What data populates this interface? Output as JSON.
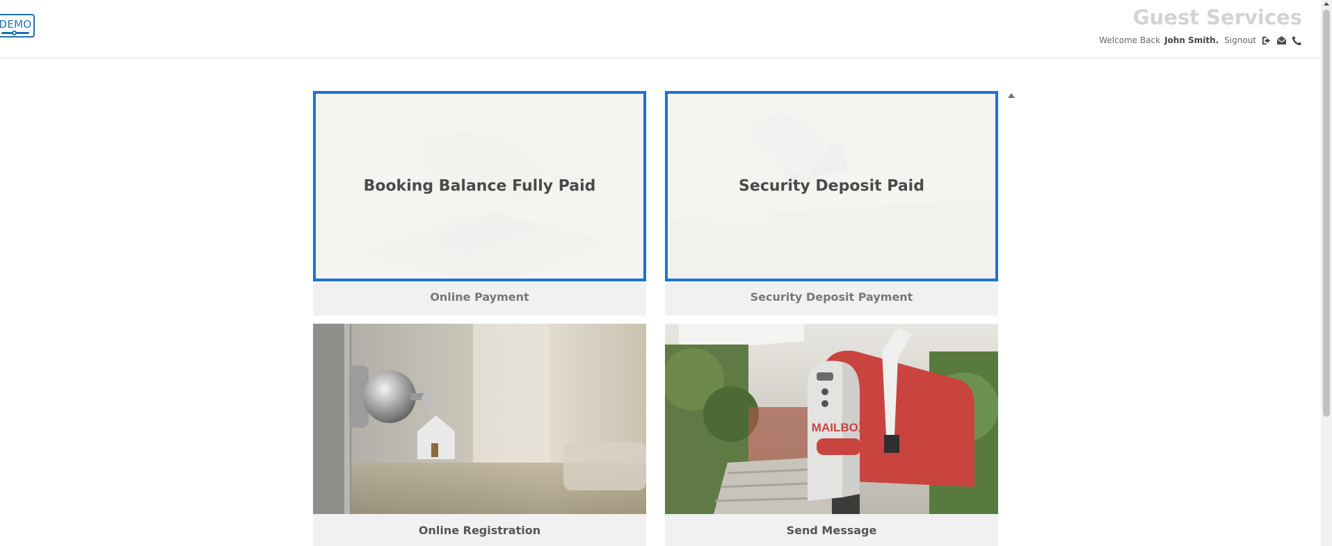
{
  "header": {
    "logo_text": "DEMO",
    "title": "Guest Services",
    "welcome_prefix": "Welcome Back",
    "user_name": "John Smith.",
    "signout_label": "Signout",
    "icons": [
      "signout-icon",
      "envelope-icon",
      "phone-icon"
    ]
  },
  "cards": [
    {
      "id": "online-payment",
      "overlay": "Booking Balance Fully Paid",
      "label": "Online Payment"
    },
    {
      "id": "security-deposit",
      "overlay": "Security Deposit Paid",
      "label": "Security Deposit Payment"
    },
    {
      "id": "online-registration",
      "label": "Online Registration",
      "image_text": ""
    },
    {
      "id": "send-message",
      "label": "Send Message",
      "image_text": "MAILBOX"
    }
  ],
  "colors": {
    "accent_border": "#1a73d4",
    "logo": "#1e6fb0",
    "title": "#d3d3d3",
    "mailbox": "#c9443f"
  }
}
